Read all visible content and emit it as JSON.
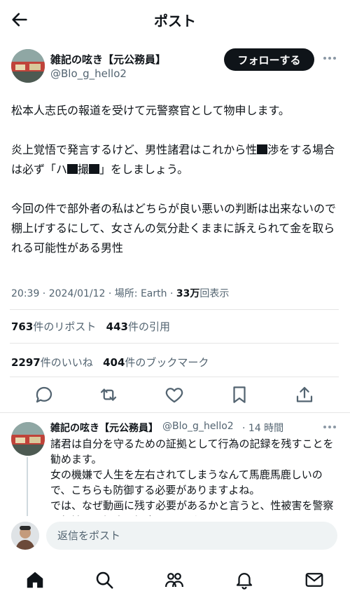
{
  "header": {
    "title": "ポスト"
  },
  "post": {
    "author_name": "雑記の呟き【元公務員】",
    "handle": "@Blo_g_hello2",
    "follow_label": "フォローする",
    "line1": "松本人志氏の報道を受けて元警察官として物申します。",
    "p2_a": "炎上覚悟で発言するけど、男性諸君はこれから性",
    "p2_b": "渉をする場合は必ず「ハ",
    "p2_c": "撮",
    "p2_d": "」をしましょう。",
    "p3": "今回の件で部外者の私はどちらが良い悪いの判断は出来ないので棚上げするにして、女さんの気分赴くままに訴えられて金を取られる可能性がある男性",
    "time": "20:39",
    "date": "2024/01/12",
    "location": "場所: Earth",
    "views_count": "33万",
    "views_label": "回表示",
    "reposts_count": "763",
    "reposts_label": "件のリポスト",
    "quotes_count": "443",
    "quotes_label": "件の引用",
    "likes_count": "2297",
    "likes_label": "件のいいね",
    "bookmarks_count": "404",
    "bookmarks_label": "件のブックマーク"
  },
  "reply": {
    "author_name": "雑記の呟き【元公務員】",
    "handle": "@Blo_g_hello2",
    "age": "14 時間",
    "line1": "諸君は自分を守るための証拠として行為の記録を残すことを勧めます。",
    "line2": "女の機嫌で人生を左右されてしまうなんて馬鹿馬鹿しいので、こちらも防御する必要がありますよね。",
    "line3": "では、なぜ動画に残す必要があるかと言うと、性被害を警察に相談した場合に調書という形でいろいろ聞かれるんです"
  },
  "compose": {
    "placeholder": "返信をポスト"
  },
  "icons": {
    "back": "arrow-left-icon",
    "more": "more-dots-icon",
    "reply": "reply-bubble-icon",
    "repost": "repost-icon",
    "like": "heart-icon",
    "bookmark": "bookmark-icon",
    "share": "share-icon",
    "home": "home-icon",
    "search": "search-icon",
    "communities": "communities-icon",
    "notifications": "bell-icon",
    "messages": "mail-icon"
  },
  "colors": {
    "text": "#0f1419",
    "secondary": "#536471",
    "follow_bg": "#0f1419"
  }
}
